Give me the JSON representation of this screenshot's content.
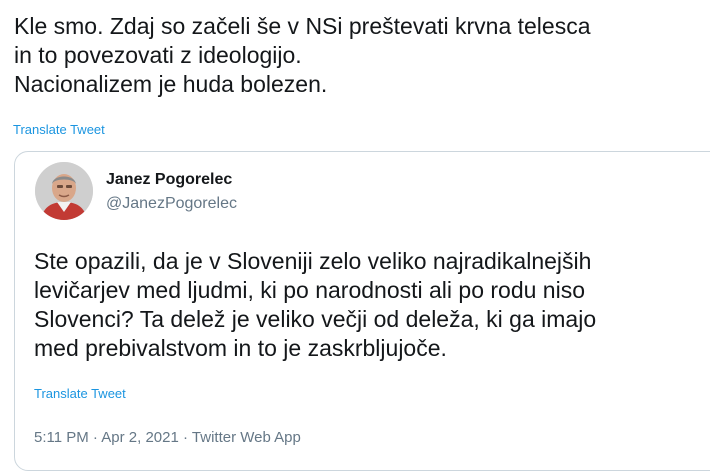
{
  "tweet": {
    "text_lines": [
      "Kle smo. Zdaj so začeli še v NSi preštevati krvna telesca",
      "in to povezovati z ideologijo.",
      "Nacionalizem je huda bolezen."
    ],
    "translate_label": "Translate Tweet"
  },
  "quoted_tweet": {
    "author_name": "Janez Pogorelec",
    "author_handle": "@JanezPogorelec",
    "text_lines": [
      "Ste opazili, da je v Sloveniji zelo veliko najradikalnejših",
      "levičarjev med ljudmi, ki po narodnosti ali po rodu niso",
      "Slovenci? Ta delež je veliko večji od deleža, ki ga imajo",
      "med prebivalstvom in to je zaskrbljujoče."
    ],
    "translate_label": "Translate Tweet",
    "time": "5:11 PM",
    "separator": "·",
    "date": "Apr 2, 2021",
    "source": "Twitter Web App"
  },
  "colors": {
    "link": "#1b95e0",
    "text": "#14171a",
    "secondary": "#657786",
    "border": "#ccd6dd"
  }
}
